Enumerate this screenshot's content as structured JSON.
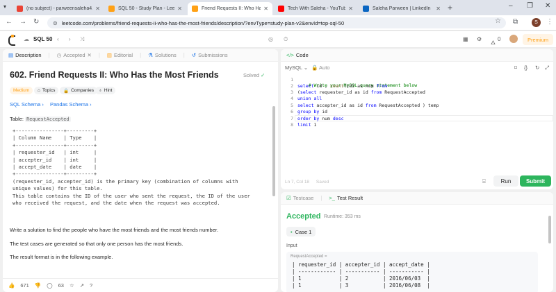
{
  "browser": {
    "tabs": [
      {
        "label": "(no subject) - parweensaleha4...",
        "color": "#ea4335"
      },
      {
        "label": "SQL 50 - Study Plan - LeetCode",
        "color": "#ffa116"
      },
      {
        "label": "Friend Requests II: Who Has th...",
        "color": "#ffa116"
      },
      {
        "label": "Tech With Saleha - YouTube",
        "color": "#ff0000"
      },
      {
        "label": "Saleha Parween | LinkedIn",
        "color": "#0a66c2"
      }
    ],
    "url": "leetcode.com/problems/friend-requests-ii-who-has-the-most-friends/description/?envType=study-plan-v2&envId=top-sql-50",
    "profile_initial": "S"
  },
  "leetcode_bar": {
    "list_name": "SQL 50",
    "streak_count": "0",
    "premium_label": "Premium"
  },
  "left_tabs": {
    "description": "Description",
    "accepted": "Accepted",
    "editorial": "Editorial",
    "solutions": "Solutions",
    "submissions": "Submissions"
  },
  "problem": {
    "title": "602. Friend Requests II: Who Has the Most Friends",
    "solved_label": "Solved",
    "difficulty": "Medium",
    "topics_label": "Topics",
    "companies_label": "Companies",
    "hint_label": "Hint",
    "sql_schema_link": "SQL Schema",
    "pandas_schema_link": "Pandas Schema",
    "table_prefix": "Table:",
    "table_name": "RequestAccepted",
    "schema_text": "+----------------+---------+\n| Column Name    | Type    |\n+----------------+---------+\n| requester_id   | int     |\n| accepter_id    | int     |\n| accept_date    | date    |\n+----------------+---------+\n(requester_id, accepter_id) is the primary key (combination of columns with\nunique values) for this table.\nThis table contains the ID of the user who sent the request, the ID of the user\nwho received the request, and the date when the request was accepted.",
    "para1": "Write a solution to find the people who have the most friends and the most friends number.",
    "para2": "The test cases are generated so that only one person has the most friends.",
    "para3": "The result format is in the following example.",
    "likes": "671",
    "comments": "63"
  },
  "code_panel": {
    "title": "Code",
    "language": "MySQL",
    "auto_label": "Auto",
    "lines": [
      "1",
      "2",
      "3",
      "4",
      "5",
      "6",
      "7",
      "8"
    ],
    "line1": "# Write your MySQL query statement below",
    "line2_a": "select",
    "line2_b": " id , ",
    "line2_c": "count",
    "line2_d": "(id) as num ",
    "line2_e": "from",
    "line3_a": "(",
    "line3_b": "select",
    "line3_c": " requester_id as id ",
    "line3_d": "from",
    "line3_e": " RequestAccepted",
    "line4": "union all",
    "line5_a": "select",
    "line5_b": " accepter_id as id ",
    "line5_c": "from",
    "line5_d": " RequestAccepted ) temp",
    "line6_a": "group by",
    "line6_b": " id",
    "line7_a": "order by",
    "line7_b": " num ",
    "line7_c": "desc",
    "line8_a": "limit",
    "line8_b": " 1",
    "status_pos": "Ln 7, Col 18",
    "status_saved": "Saved",
    "run_label": "Run",
    "submit_label": "Submit"
  },
  "result_panel": {
    "testcase_tab": "Testcase",
    "result_tab": "Test Result",
    "verdict": "Accepted",
    "runtime": "Runtime: 353 ms",
    "case_label": "Case 1",
    "input_label": "Input",
    "input_table_tag": "RequestAccepted =",
    "table_rows": [
      "| requester_id | accepter_id | accept_date |",
      "| ------------ | ----------- | ----------- |",
      "| 1            | 2           | 2016/06/03  |",
      "| 1            | 3           | 2016/06/08  |"
    ]
  }
}
